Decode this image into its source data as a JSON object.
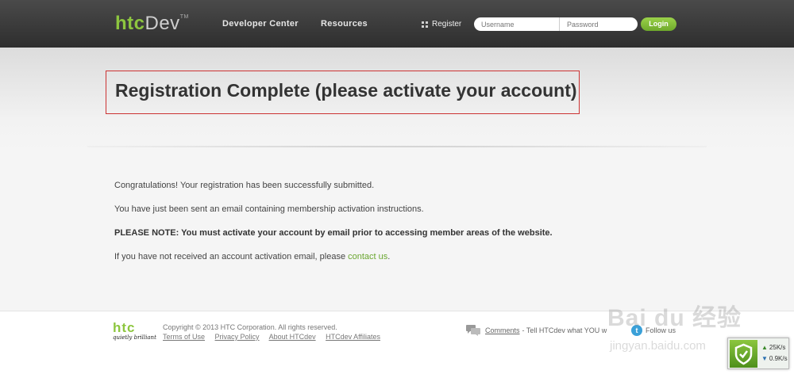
{
  "header": {
    "logo_htc": "htc",
    "logo_dev": "Dev",
    "logo_tm": "TM",
    "nav": [
      "Developer Center",
      "Resources"
    ],
    "register_label": "Register",
    "username_placeholder": "Username",
    "password_placeholder": "Password",
    "login_label": "Login"
  },
  "main": {
    "title": "Registration Complete (please activate your account)",
    "p1": "Congratulations! Your registration has been successfully submitted.",
    "p2": "You have just been sent an email containing membership activation instructions.",
    "p3": "PLEASE NOTE: You must activate your account by email prior to accessing member areas of the website.",
    "p4_text": "If you have not received an account activation email, please ",
    "p4_link": "contact us",
    "p4_end": "."
  },
  "footer": {
    "logo": "htc",
    "tagline": "quietly brilliant",
    "copyright": "Copyright © 2013 HTC Corporation. All rights reserved.",
    "links": [
      "Terms of Use",
      "Privacy Policy",
      "About HTCdev",
      "HTCdev Affiliates"
    ],
    "comments_link": "Comments",
    "comments_text": "- Tell HTCdev what YOU w",
    "follow_text": "Follow us"
  },
  "watermark": {
    "line1": "Bai du 经验",
    "line2": "jingyan.baidu.com"
  },
  "speed_widget": {
    "up": "25K/s",
    "down": "0.9K/s"
  },
  "colors": {
    "accent": "#8dc63f",
    "title_border": "#cc3333",
    "link": "#6aa62f"
  }
}
